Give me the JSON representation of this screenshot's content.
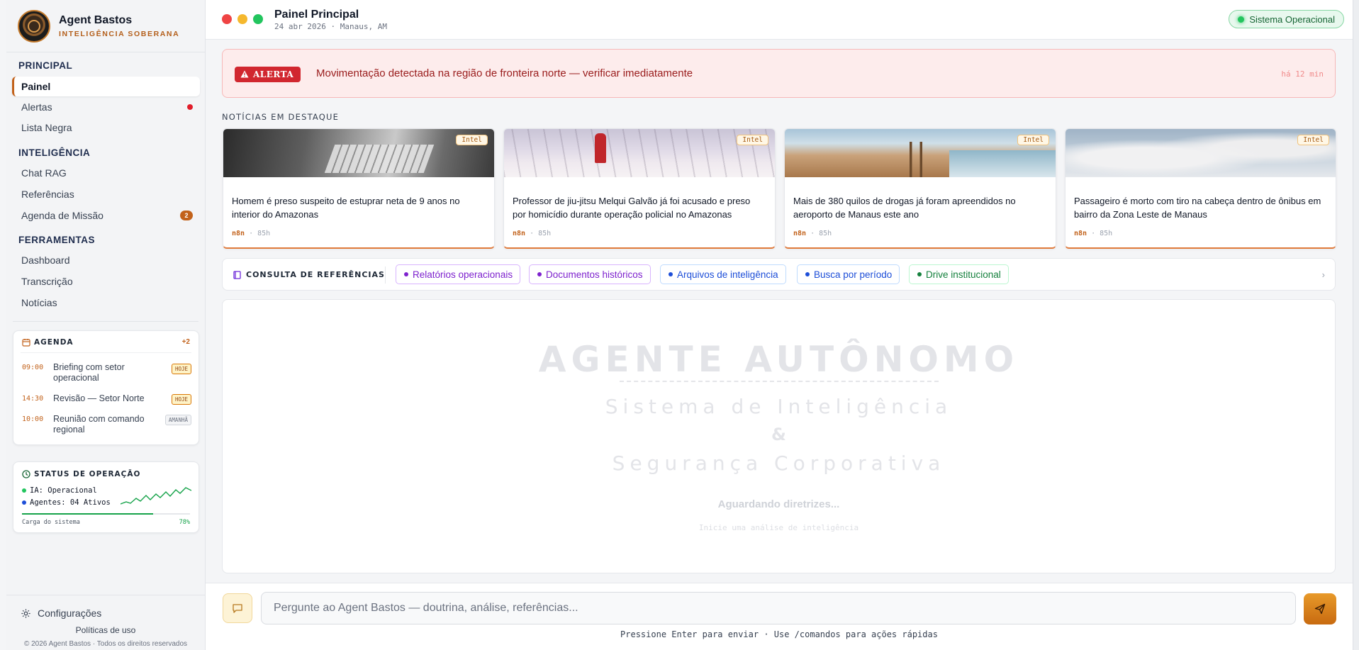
{
  "brand": {
    "name": "Agent Bastos",
    "subtitle": "INTELIGÊNCIA SOBERANA"
  },
  "sidebar": {
    "sections": [
      {
        "title": "PRINCIPAL",
        "items": [
          {
            "label": "Painel",
            "active": true
          },
          {
            "label": "Alertas",
            "indicator": "dot"
          },
          {
            "label": "Lista Negra"
          }
        ]
      },
      {
        "title": "INTELIGÊNCIA",
        "items": [
          {
            "label": "Chat RAG"
          },
          {
            "label": "Referências"
          },
          {
            "label": "Agenda de Missão",
            "badge": "2"
          }
        ]
      },
      {
        "title": "FERRAMENTAS",
        "items": [
          {
            "label": "Dashboard"
          },
          {
            "label": "Transcrição"
          },
          {
            "label": "Notícias"
          }
        ]
      }
    ],
    "agenda": {
      "title": "AGENDA",
      "more": "+2",
      "items": [
        {
          "time": "09:00",
          "title": "Briefing com setor operacional",
          "tag": "HOJE"
        },
        {
          "time": "14:30",
          "title": "Revisão — Setor Norte",
          "tag": "HOJE"
        },
        {
          "time": "10:00",
          "title": "Reunião com comando regional",
          "tag": "AMANHÃ"
        }
      ]
    },
    "status": {
      "title": "STATUS DE OPERAÇÃO",
      "ia": "IA: Operacional",
      "agents": "Agentes: 04 Ativos",
      "load_label": "Carga do sistema",
      "load_value": "78%",
      "load_fraction": 0.78
    },
    "footer": {
      "settings": "Configurações",
      "policy": "Políticas de uso",
      "copyright": "© 2026 Agent Bastos · Todos os direitos reservados"
    }
  },
  "header": {
    "title": "Painel Principal",
    "subtitle": "24 abr 2026 · Manaus, AM",
    "status": "Sistema Operacional"
  },
  "alert": {
    "tag": "ALERTA",
    "message": "Movimentação detectada na região de fronteira norte — verificar imediatamente",
    "time": "há 12 min"
  },
  "news": {
    "heading": "NOTÍCIAS EM DESTAQUE",
    "items": [
      {
        "tag": "Intel",
        "title": "Homem é preso suspeito de estuprar neta de 9 anos no interior do Amazonas",
        "source": "n8n",
        "age": "85h"
      },
      {
        "tag": "Intel",
        "title": "Professor de jiu-jitsu Melqui Galvão já foi acusado e preso por homicídio durante operação policial no Amazonas",
        "source": "n8n",
        "age": "85h"
      },
      {
        "tag": "Intel",
        "title": "Mais de 380 quilos de drogas já foram apreendidos no aeroporto de Manaus este ano",
        "source": "n8n",
        "age": "85h"
      },
      {
        "tag": "Intel",
        "title": "Passageiro é morto com tiro na cabeça dentro de ônibus em bairro da Zona Leste de Manaus",
        "source": "n8n",
        "age": "85h"
      }
    ]
  },
  "references": {
    "title": "CONSULTA DE REFERÊNCIAS",
    "chips": [
      {
        "label": "Relatórios operacionais",
        "color": "#7e22ce"
      },
      {
        "label": "Documentos históricos",
        "color": "#7e22ce"
      },
      {
        "label": "Arquivos de inteligência",
        "color": "#1d4ed8"
      },
      {
        "label": "Busca por período",
        "color": "#1d4ed8"
      },
      {
        "label": "Drive institucional",
        "color": "#15803d"
      }
    ],
    "arrow": "›"
  },
  "canvas": {
    "title": "AGENTE AUTÔNOMO",
    "line1": "Sistema de Inteligência",
    "amp": "&",
    "line2": "Segurança Corporativa",
    "waiting": "Aguardando diretrizes...",
    "hint": "Inicie uma análise de inteligência"
  },
  "composer": {
    "placeholder": "Pergunte ao Agent Bastos — doutrina, análise, referências...",
    "hint": "Pressione Enter para enviar · Use /comandos para ações rápidas"
  },
  "colors": {
    "accent": "#c2621b",
    "alert": "#d1272f",
    "ok": "#22c55e"
  }
}
